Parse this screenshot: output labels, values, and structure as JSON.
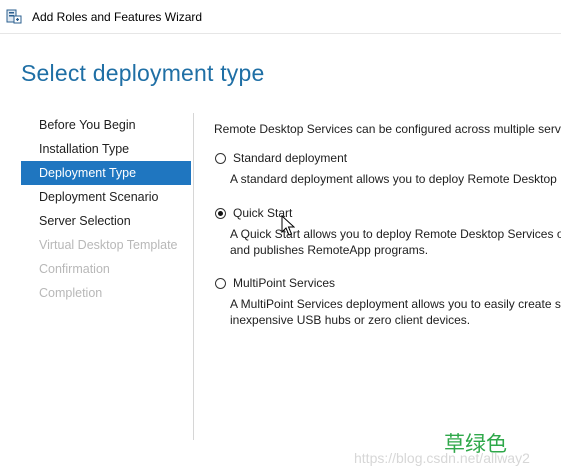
{
  "window": {
    "title": "Add Roles and Features Wizard"
  },
  "page": {
    "heading": "Select deployment type"
  },
  "sidebar": {
    "items": [
      {
        "label": "Before You Begin",
        "state": "normal"
      },
      {
        "label": "Installation Type",
        "state": "normal"
      },
      {
        "label": "Deployment Type",
        "state": "active"
      },
      {
        "label": "Deployment Scenario",
        "state": "normal"
      },
      {
        "label": "Server Selection",
        "state": "normal"
      },
      {
        "label": "Virtual Desktop Template",
        "state": "disabled"
      },
      {
        "label": "Confirmation",
        "state": "disabled"
      },
      {
        "label": "Completion",
        "state": "disabled"
      }
    ]
  },
  "content": {
    "intro": "Remote Desktop Services can be configured across multiple serve",
    "options": [
      {
        "label": "Standard deployment",
        "selected": false,
        "description": [
          "A standard deployment allows you to deploy Remote Desktop"
        ]
      },
      {
        "label": "Quick Start",
        "selected": true,
        "description": [
          "A Quick Start allows you to deploy Remote Desktop Services or",
          "and publishes RemoteApp programs."
        ]
      },
      {
        "label": "MultiPoint Services",
        "selected": false,
        "description": [
          "A MultiPoint Services deployment allows you to easily create st",
          "inexpensive USB hubs or zero client devices."
        ]
      }
    ]
  },
  "watermark": {
    "logo_text": "草绿色",
    "url": "https://blog.csdn.net/allway2"
  },
  "colors": {
    "heading": "#1f6fa5",
    "active_nav_bg": "#1f76c0",
    "disabled_text": "#b8b8b8",
    "watermark_green": "#2fa84a"
  },
  "icons": [
    "server-manager-app-icon",
    "mouse-pointer-icon"
  ]
}
